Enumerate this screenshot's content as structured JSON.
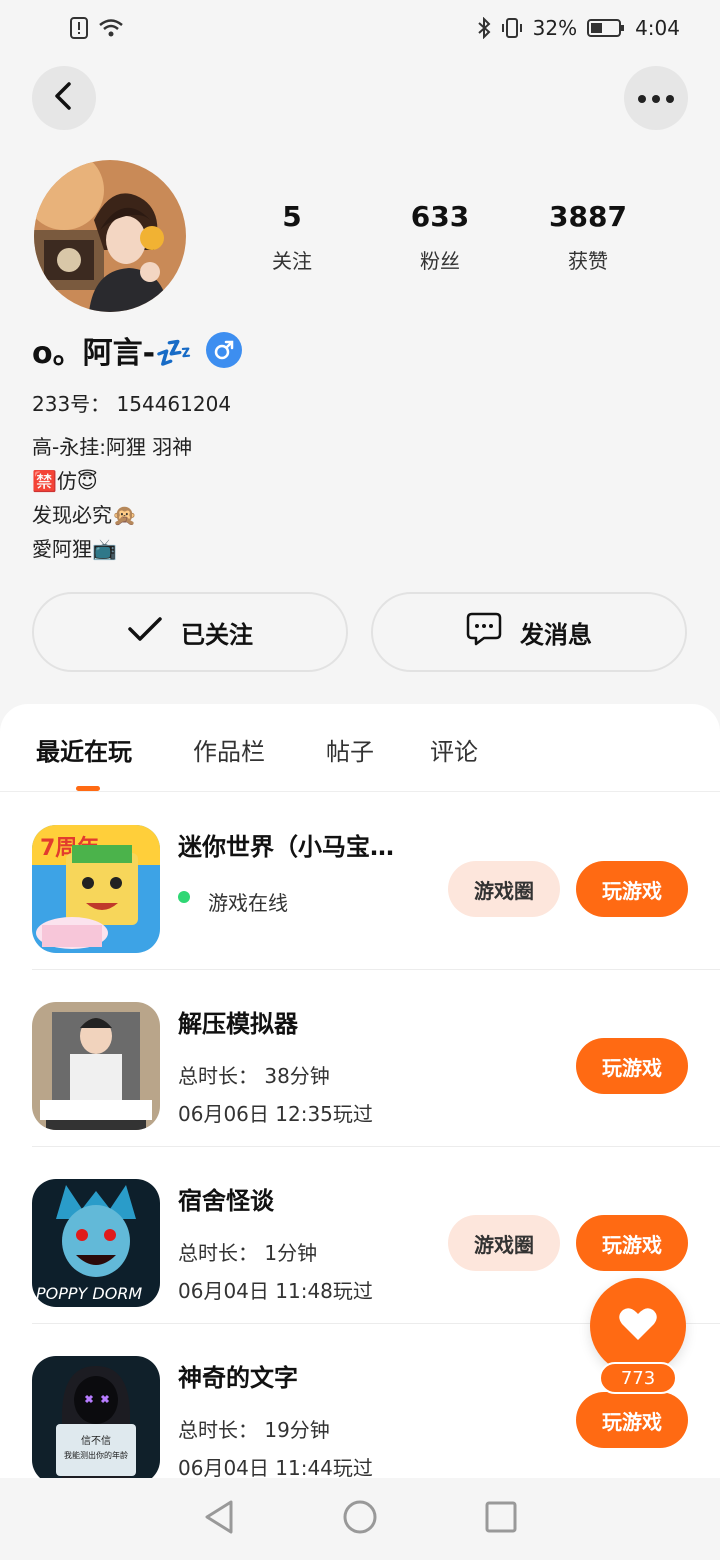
{
  "status_bar": {
    "battery": "32%",
    "time": "4:04"
  },
  "profile": {
    "stats": [
      {
        "value": "5",
        "label": "关注"
      },
      {
        "value": "633",
        "label": "粉丝"
      },
      {
        "value": "3887",
        "label": "获赞"
      }
    ],
    "username": "o。阿言-💤",
    "uid": "233号： 154461204",
    "bio_lines": [
      "高-永挂:阿狸 羽神",
      "🈲仿😇",
      "发现必究🙊",
      "愛阿狸📺"
    ]
  },
  "actions": {
    "follow_label": "已关注",
    "message_label": "发消息"
  },
  "tabs": [
    "最近在玩",
    "作品栏",
    "帖子",
    "评论"
  ],
  "games": [
    {
      "title": "迷你世界（小马宝…",
      "line1": "游戏在线",
      "line2": "",
      "circle_label": "游戏圈",
      "play_label": "玩游戏",
      "icon": "mini-world-icon"
    },
    {
      "title": "解压模拟器",
      "line1": "总时长： 38分钟",
      "line2": "06月06日 12:35玩过",
      "circle_label": "",
      "play_label": "玩游戏",
      "icon": "stress-sim-icon"
    },
    {
      "title": "宿舍怪谈",
      "line1": "总时长： 1分钟",
      "line2": "06月04日 11:48玩过",
      "circle_label": "游戏圈",
      "play_label": "玩游戏",
      "icon": "dorm-horror-icon"
    },
    {
      "title": "神奇的文字",
      "line1": "总时长： 19分钟",
      "line2": "06月04日 11:44玩过",
      "circle_label": "",
      "play_label": "玩游戏",
      "icon": "magic-text-icon"
    }
  ],
  "game_icon_texts": {
    "mini_world_badge": "7周年",
    "dorm_caption": "POPPY DORM",
    "magic_line1": "信不信",
    "magic_line2": "我能测出你的年龄"
  },
  "like": {
    "count": "773"
  },
  "colors": {
    "accent": "#ff6a13",
    "online": "#2fd774",
    "gender": "#3d8ef0"
  }
}
